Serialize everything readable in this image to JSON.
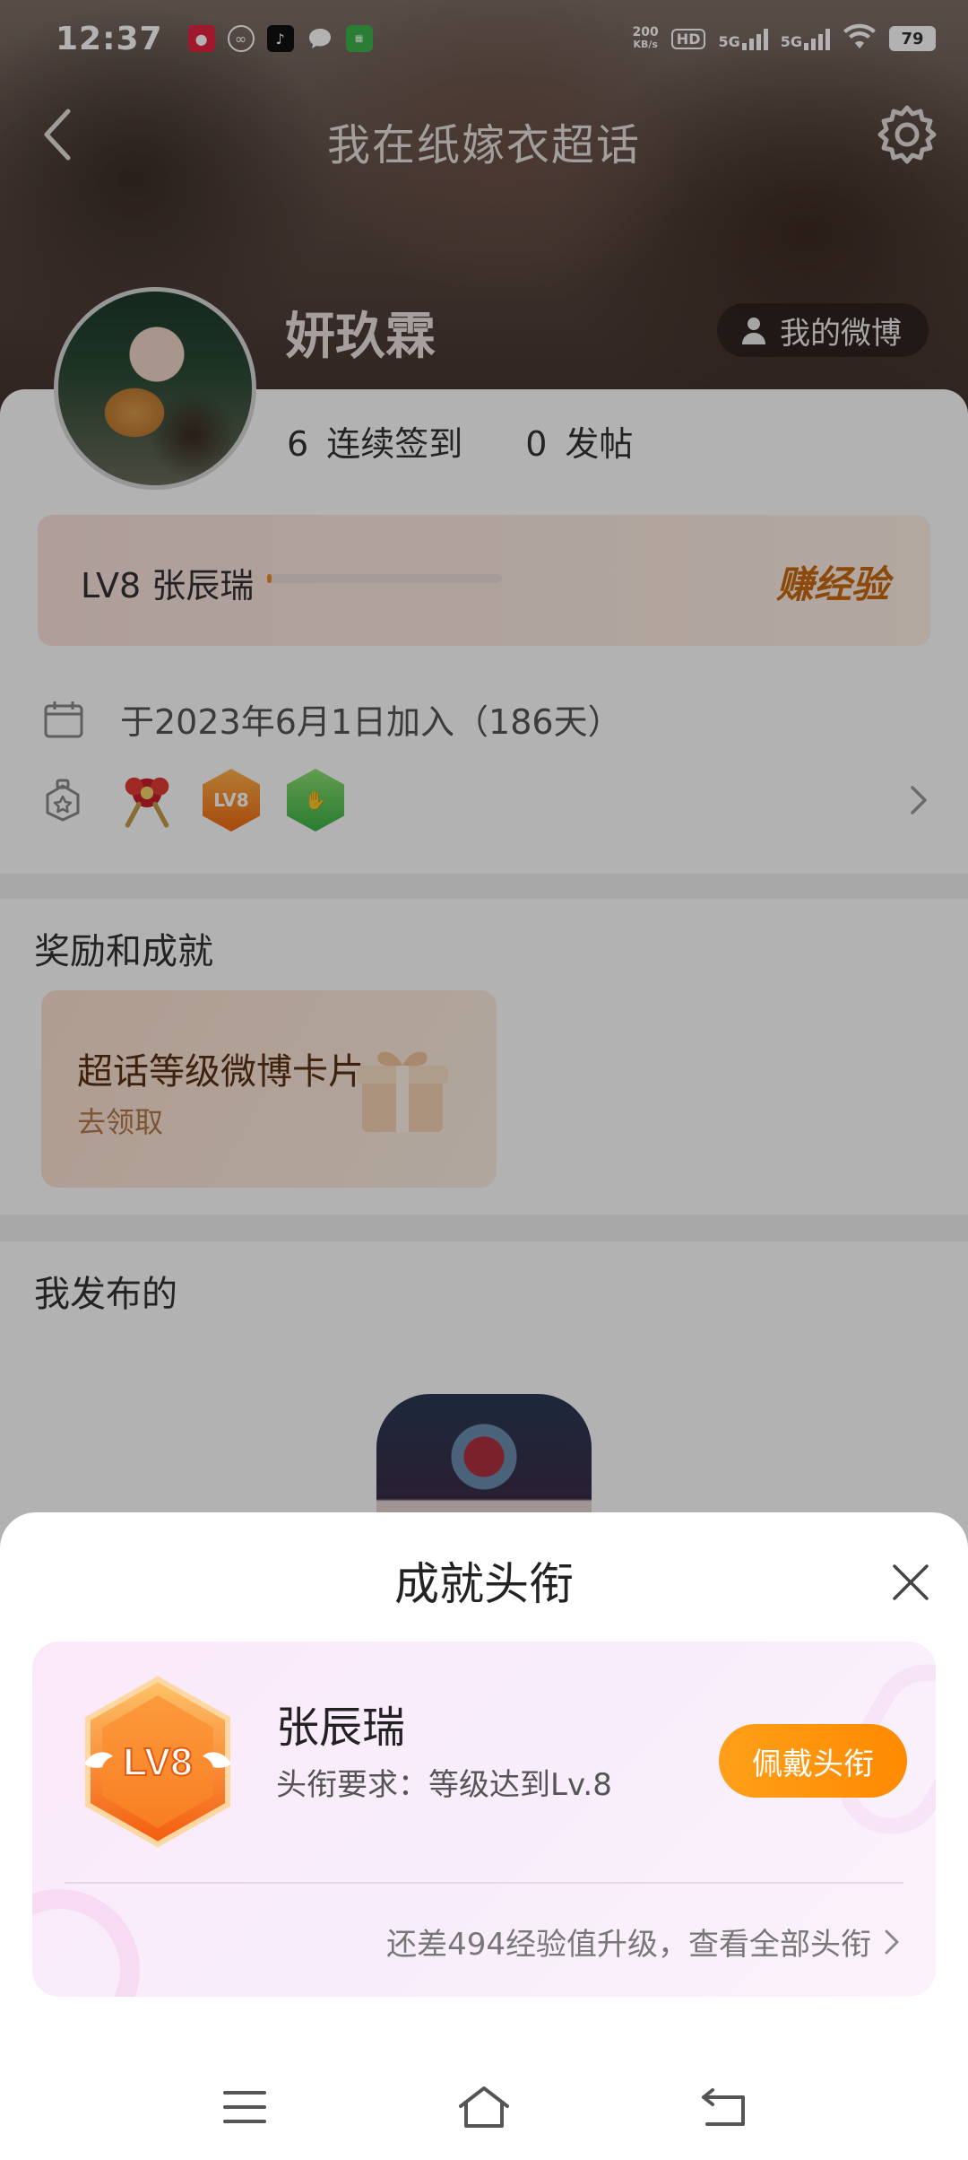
{
  "status_bar": {
    "time": "12:37",
    "speed_value": "200",
    "speed_unit": "KB/s",
    "hd": "HD",
    "sim1": "5G",
    "sim2": "5G",
    "battery": "79"
  },
  "header": {
    "title": "我在纸嫁衣超话"
  },
  "profile": {
    "username": "妍玖霖",
    "my_weibo": "我的微博",
    "checkin_count": "6",
    "checkin_label": "连续签到",
    "posts_count": "0",
    "posts_label": "发帖"
  },
  "level": {
    "label": "LV8 张辰瑞",
    "progress": 0.02,
    "earn_exp": "赚经验"
  },
  "joined_text": "于2023年6月1日加入（186天）",
  "badges": [
    "opera-badge",
    "lv8-badge",
    "green-hand-badge"
  ],
  "rewards": {
    "section_title": "奖励和成就",
    "card_title": "超话等级微博卡片",
    "card_action": "去领取"
  },
  "posts": {
    "section_title": "我发布的"
  },
  "sheet": {
    "title": "成就头衔",
    "badge_text": "LV8",
    "title_name": "张辰瑞",
    "requirement": "头衔要求：等级达到Lv.8",
    "wear_button": "佩戴头衔",
    "footer_text": "还差494经验值升级，查看全部头衔"
  },
  "colors": {
    "accent_orange": "#ff9200",
    "earn_exp": "#c86a10",
    "sheet_card_bg": "#f9ecfa"
  }
}
